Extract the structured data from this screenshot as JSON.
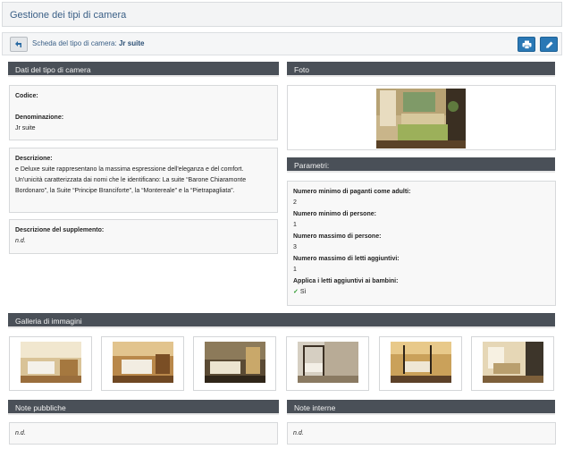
{
  "page": {
    "title": "Gestione dei tipi di camera"
  },
  "subbar": {
    "label": "Scheda del tipo di camera:",
    "name": "Jr suite",
    "back_icon": "back-arrow-icon",
    "print_icon": "printer-icon",
    "edit_icon": "pencil-icon"
  },
  "dati": {
    "header": "Dati del tipo di camera",
    "codice_label": "Codice:",
    "codice_value": "",
    "denominazione_label": "Denominazione:",
    "denominazione_value": "Jr suite",
    "descrizione_label": "Descrizione:",
    "descrizione_value": "e Deluxe suite rappresentano la massima espressione dell'eleganza e del comfort. Un'unicità caratterizzata dai nomi che le identificano: La suite “Barone Chiaramonte Bordonaro”, la Suite “Principe Branciforte”, la “Montereale” e la “Pietrapagliata”.",
    "supplemento_label": "Descrizione del supplemento:",
    "supplemento_value": "n.d."
  },
  "foto": {
    "header": "Foto"
  },
  "parametri": {
    "header": "Parametri:",
    "items": [
      {
        "label": "Numero minimo di paganti come adulti:",
        "value": "2"
      },
      {
        "label": "Numero minimo di persone:",
        "value": "1"
      },
      {
        "label": "Numero massimo di persone:",
        "value": "3"
      },
      {
        "label": "Numero massimo di letti aggiuntivi:",
        "value": "1"
      },
      {
        "label": "Applica i letti aggiuntivi ai bambini:",
        "value": "Sì"
      }
    ],
    "check_icon": "checkmark-icon"
  },
  "galleria": {
    "header": "Galleria di immagini",
    "count": 6
  },
  "note_pubbliche": {
    "header": "Note pubbliche",
    "value": "n.d."
  },
  "note_interne": {
    "header": "Note interne",
    "value": "n.d."
  },
  "colors": {
    "header_bg": "#4a5058",
    "button_blue": "#2a78b5",
    "title_blue": "#3a5f86"
  }
}
